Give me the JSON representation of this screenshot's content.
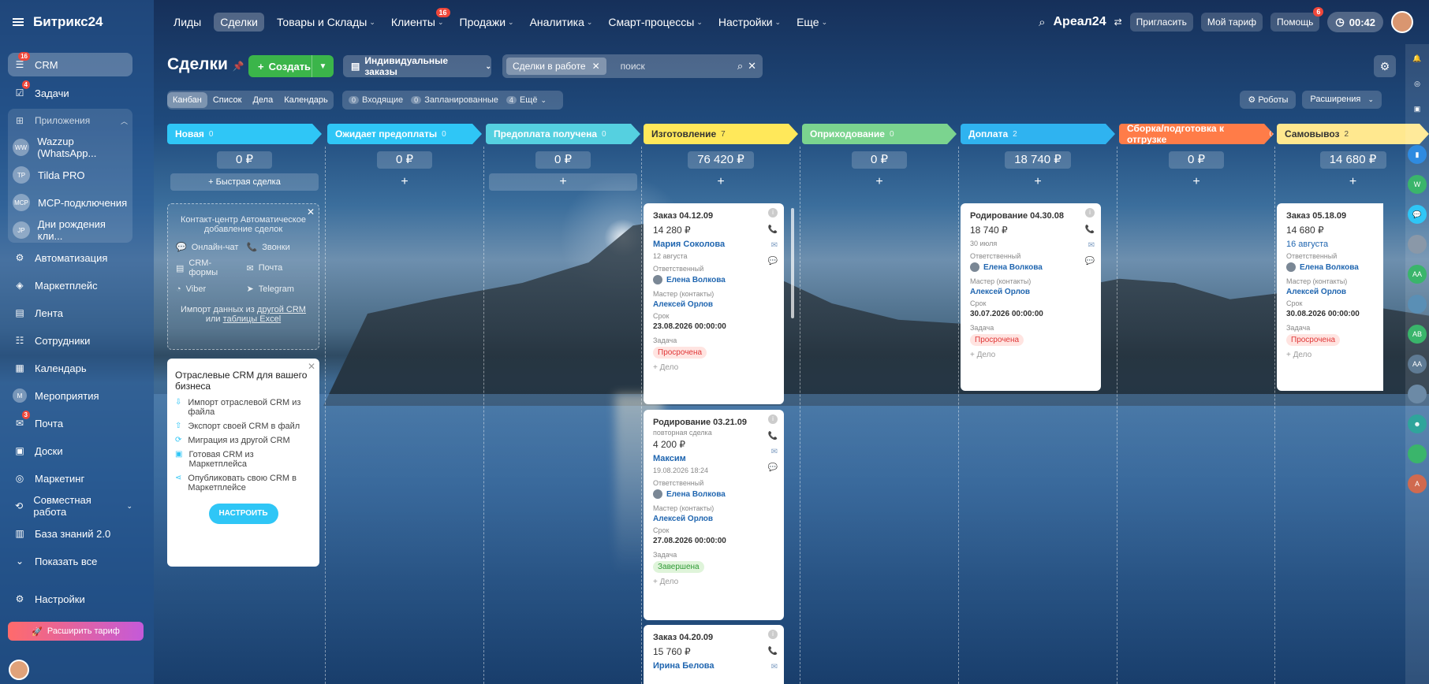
{
  "app": {
    "logo": "Битрикс24",
    "logo_sup": "©"
  },
  "topnav": {
    "items": [
      {
        "label": "Лиды"
      },
      {
        "label": "Сделки",
        "active": true
      },
      {
        "label": "Товары и Склады",
        "caret": true
      },
      {
        "label": "Клиенты",
        "caret": true,
        "badge": "16"
      },
      {
        "label": "Продажи",
        "caret": true
      },
      {
        "label": "Аналитика",
        "caret": true
      },
      {
        "label": "Смарт-процессы",
        "caret": true
      },
      {
        "label": "Настройки",
        "caret": true
      },
      {
        "label": "Еще",
        "caret": true
      }
    ],
    "brand": "Ареал24",
    "invite": "Пригласить",
    "tariff": "Мой тариф",
    "help": "Помощь",
    "help_badge": "6",
    "timer": "00:42"
  },
  "sidebar": {
    "items": [
      {
        "label": "CRM",
        "badge": "16",
        "icon": "crm-icon"
      },
      {
        "label": "Задачи",
        "badge": "4",
        "icon": "tasks-icon"
      },
      {
        "label": "Приложения",
        "icon": "apps-icon"
      },
      {
        "label": "Wazzup (WhatsApp...",
        "abbr": "WW"
      },
      {
        "label": "Tilda PRO",
        "abbr": "TP"
      },
      {
        "label": "MCP-подключения",
        "abbr": "MCP"
      },
      {
        "label": "Дни рождения кли...",
        "abbr": "JP"
      },
      {
        "label": "Автоматизация"
      },
      {
        "label": "Маркетплейс"
      },
      {
        "label": "Лента"
      },
      {
        "label": "Сотрудники"
      },
      {
        "label": "Календарь"
      },
      {
        "label": "Мероприятия",
        "abbr": "M"
      },
      {
        "label": "Почта",
        "badge": "3"
      },
      {
        "label": "Доски"
      },
      {
        "label": "Маркетинг"
      },
      {
        "label": "Совместная работа"
      },
      {
        "label": "База знаний 2.0"
      },
      {
        "label": "Показать все"
      }
    ],
    "settings": "Настройки",
    "expand": "Расширить тариф"
  },
  "toolbar": {
    "title": "Сделки",
    "create": "Создать",
    "category": "Индивидуальные заказы",
    "filter_chip": "Сделки в работе",
    "search_placeholder": "поиск",
    "views": [
      "Канбан",
      "Список",
      "Дела",
      "Календарь"
    ],
    "counters": [
      {
        "n": "0",
        "label": "Входящие"
      },
      {
        "n": "0",
        "label": "Запланированные"
      },
      {
        "n": "4",
        "label": "Ещё"
      }
    ],
    "robots": "Роботы",
    "extensions": "Расширения"
  },
  "columns": [
    {
      "name": "Новая",
      "count": "0",
      "sum": "0 ₽",
      "color": "#2fc6f6"
    },
    {
      "name": "Ожидает предоплаты",
      "count": "0",
      "sum": "0 ₽",
      "color": "#2fc6f6"
    },
    {
      "name": "Предоплата получена",
      "count": "0",
      "sum": "0 ₽",
      "color": "#55d0e0"
    },
    {
      "name": "Изготовление",
      "count": "7",
      "sum": "76 420 ₽",
      "color": "#ffe85a"
    },
    {
      "name": "Оприходование",
      "count": "0",
      "sum": "0 ₽",
      "color": "#7bd48f"
    },
    {
      "name": "Доплата",
      "count": "2",
      "sum": "18 740 ₽",
      "color": "#2fb3f0"
    },
    {
      "name": "Сборка/подготовка к отгрузке",
      "count": "0",
      "sum": "0 ₽",
      "color": "#ff7c48"
    },
    {
      "name": "Самовывоз",
      "count": "2",
      "sum": "14 680 ₽",
      "color": "#ffe88f"
    }
  ],
  "quick_deal": "Быстрая сделка",
  "promo": {
    "title": "Контакт-центр Автоматическое добавление сделок",
    "channels": [
      "Онлайн-чат",
      "Звонки",
      "CRM-формы",
      "Почта",
      "Viber",
      "Telegram"
    ],
    "import1": "Импорт данных из",
    "link1": "другой CRM",
    "or": "или",
    "link2": "таблицы Excel"
  },
  "promo2": {
    "title": "Отраслевые CRM для вашего бизнеса",
    "items": [
      "Импорт отраслевой CRM из файла",
      "Экспорт своей CRM в файл",
      "Миграция из другой CRM",
      "Готовая CRM из Маркетплейса",
      "Опубликовать свою CRM в Маркетплейсе"
    ],
    "button": "НАСТРОИТЬ"
  },
  "labels": {
    "resp": "Ответственный",
    "master": "Мастер (контакты)",
    "deadline": "Срок",
    "task": "Задача",
    "add": "+ Дело"
  },
  "cards": [
    {
      "title": "Заказ 04.12.09",
      "sum": "14 280 ₽",
      "contact": "Мария Соколова",
      "date": "12 августа",
      "resp": "Елена Волкова",
      "master": "Алексей Орлов",
      "deadline": "23.08.2026 00:00:00",
      "status": "Просрочена",
      "status_kind": "red"
    },
    {
      "title": "Родирование 03.21.09",
      "sub": "повторная сделка",
      "sum": "4 200 ₽",
      "contact": "Максим",
      "date": "19.08.2026 18:24",
      "resp": "Елена Волкова",
      "master": "Алексей Орлов",
      "deadline": "27.08.2026 00:00:00",
      "status": "Завершена",
      "status_kind": "green"
    },
    {
      "title": "Заказ 04.20.09",
      "sum": "15 760 ₽",
      "contact": "Ирина Белова"
    },
    {
      "title": "Родирование 04.30.08",
      "sum": "18 740 ₽",
      "date": "30 июля",
      "resp": "Елена Волкова",
      "master": "Алексей Орлов",
      "deadline": "30.07.2026 00:00:00",
      "status": "Просрочена",
      "status_kind": "red"
    },
    {
      "title": "Заказ 05.18.09",
      "sum": "14 680 ₽",
      "contact": "16 августа",
      "resp": "Елена Волкова",
      "master": "Алексей Орлов",
      "deadline": "30.08.2026 00:00:00",
      "status": "Просрочена",
      "status_kind": "red"
    }
  ],
  "right_rail": [
    "W",
    "АА",
    "АВ",
    "АА",
    "А"
  ]
}
